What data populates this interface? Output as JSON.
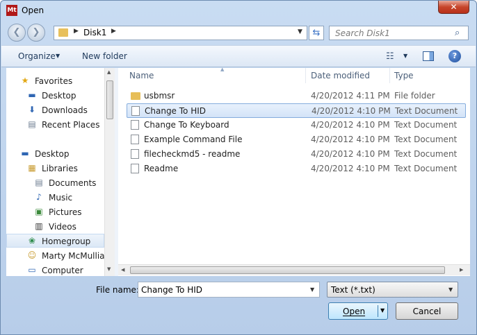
{
  "window": {
    "title": "Open",
    "app_logo": "Mt"
  },
  "nav": {
    "back": "❮",
    "forward": "❯"
  },
  "address": {
    "separator": "▶",
    "crumb": "Disk1",
    "dropdown": "▼"
  },
  "refresh": "⇆",
  "search": {
    "placeholder": "Search Disk1",
    "icon": "⌕"
  },
  "toolbar": {
    "organize": "Organize",
    "caret": "▼",
    "new_folder": "New folder",
    "views_icon": "☷",
    "help": "?"
  },
  "sidebar": {
    "items": [
      {
        "label": "Favorites",
        "icon": "★"
      },
      {
        "label": "Desktop",
        "icon": "▬"
      },
      {
        "label": "Downloads",
        "icon": "⬇"
      },
      {
        "label": "Recent Places",
        "icon": "▤"
      },
      {
        "label": "Desktop",
        "icon": "▬"
      },
      {
        "label": "Libraries",
        "icon": "▦"
      },
      {
        "label": "Documents",
        "icon": "▤"
      },
      {
        "label": "Music",
        "icon": "♪"
      },
      {
        "label": "Pictures",
        "icon": "▣"
      },
      {
        "label": "Videos",
        "icon": "▥"
      },
      {
        "label": "Homegroup",
        "icon": "❀"
      },
      {
        "label": "Marty McMulliar",
        "icon": "☺"
      },
      {
        "label": "Computer",
        "icon": "▭"
      }
    ]
  },
  "columns": {
    "name": "Name",
    "date": "Date modified",
    "type": "Type",
    "sort": "▲"
  },
  "files": [
    {
      "name": "usbmsr",
      "date": "4/20/2012 4:11 PM",
      "type": "File folder",
      "kind": "folder"
    },
    {
      "name": "Change To HID",
      "date": "4/20/2012 4:10 PM",
      "type": "Text Document",
      "kind": "doc"
    },
    {
      "name": "Change To Keyboard",
      "date": "4/20/2012 4:10 PM",
      "type": "Text Document",
      "kind": "doc"
    },
    {
      "name": "Example Command File",
      "date": "4/20/2012 4:10 PM",
      "type": "Text Document",
      "kind": "doc"
    },
    {
      "name": "filecheckmd5 - readme",
      "date": "4/20/2012 4:10 PM",
      "type": "Text Document",
      "kind": "doc"
    },
    {
      "name": "Readme",
      "date": "4/20/2012 4:10 PM",
      "type": "Text Document",
      "kind": "doc"
    }
  ],
  "scroll": {
    "up": "▲",
    "down": "▼",
    "left": "◀",
    "right": "▶"
  },
  "footer": {
    "filename_label": "File name:",
    "filename_value": "Change To HID",
    "filetype_value": "Text (*.txt)",
    "open_label": "Open",
    "cancel_label": "Cancel"
  },
  "colors": {
    "accent": "#3c7fb1",
    "selection": "#d3e3f8",
    "folder": "#e7be58",
    "close": "#c7452b"
  }
}
